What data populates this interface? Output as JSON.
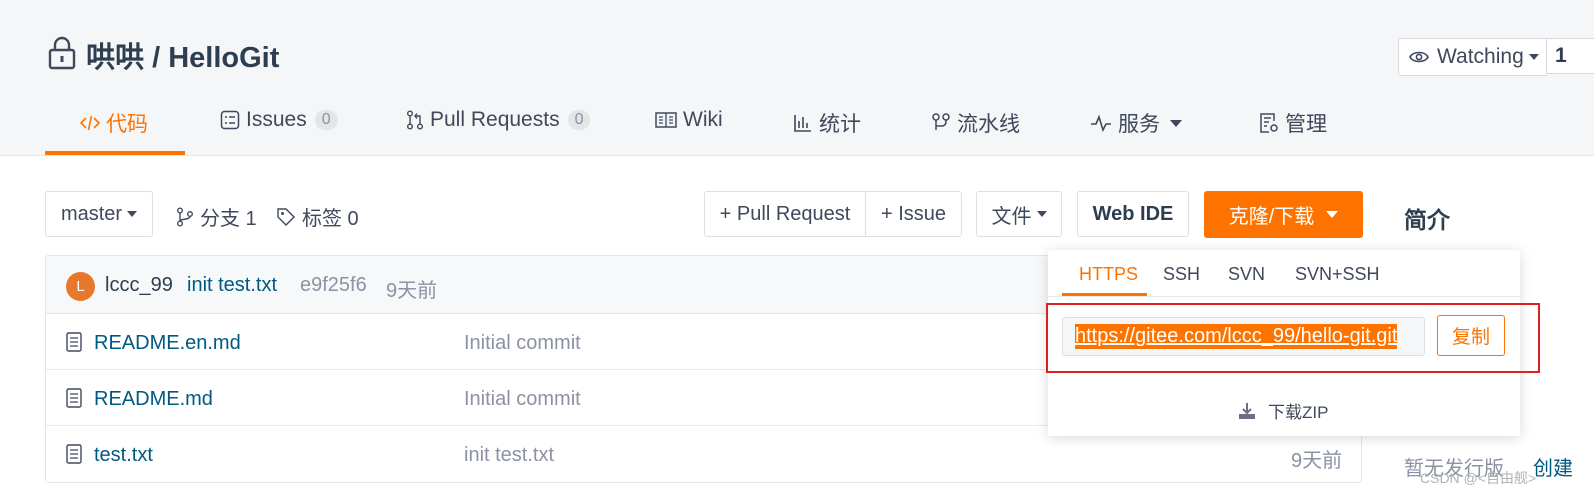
{
  "repo": {
    "owner": "哄哄",
    "separator": " / ",
    "name": "HelloGit"
  },
  "watch": {
    "label": "Watching",
    "count": "1"
  },
  "tabs": [
    {
      "label": "代码",
      "icon": "code-icon"
    },
    {
      "label": "Issues",
      "badge": "0",
      "icon": "issues-icon"
    },
    {
      "label": "Pull Requests",
      "badge": "0",
      "icon": "pull-request-icon"
    },
    {
      "label": "Wiki",
      "icon": "wiki-icon"
    },
    {
      "label": "统计",
      "icon": "stats-icon"
    },
    {
      "label": "流水线",
      "icon": "pipeline-icon"
    },
    {
      "label": "服务",
      "icon": "pulse-icon"
    },
    {
      "label": "管理",
      "icon": "settings-doc-icon"
    }
  ],
  "toolbar": {
    "branch": "master",
    "branches": "分支 1",
    "tags": "标签 0",
    "pull_request": "+ Pull Request",
    "issue": "+ Issue",
    "file": "文件",
    "web_ide": "Web IDE",
    "clone": "克隆/下载"
  },
  "side_title": "简介",
  "latest_commit": {
    "avatar": "L",
    "author": "lccc_99",
    "message": "init test.txt",
    "hash": "e9f25f6",
    "time": "9天前"
  },
  "files": [
    {
      "name": "README.en.md",
      "message": "Initial commit",
      "time": ""
    },
    {
      "name": "README.md",
      "message": "Initial commit",
      "time": ""
    },
    {
      "name": "test.txt",
      "message": "init test.txt",
      "time": "9天前"
    }
  ],
  "clone": {
    "tabs": [
      "HTTPS",
      "SSH",
      "SVN",
      "SVN+SSH"
    ],
    "url": "https://gitee.com/lccc_99/hello-git.git",
    "copy": "复制",
    "zip": "下载ZIP"
  },
  "release": {
    "text": "暂无发行版",
    "link": "创建"
  },
  "watermark": "CSDN @<自由舰>",
  "colors": {
    "accent": "#fe7300",
    "link": "#005980",
    "highlight": "#e02020"
  }
}
